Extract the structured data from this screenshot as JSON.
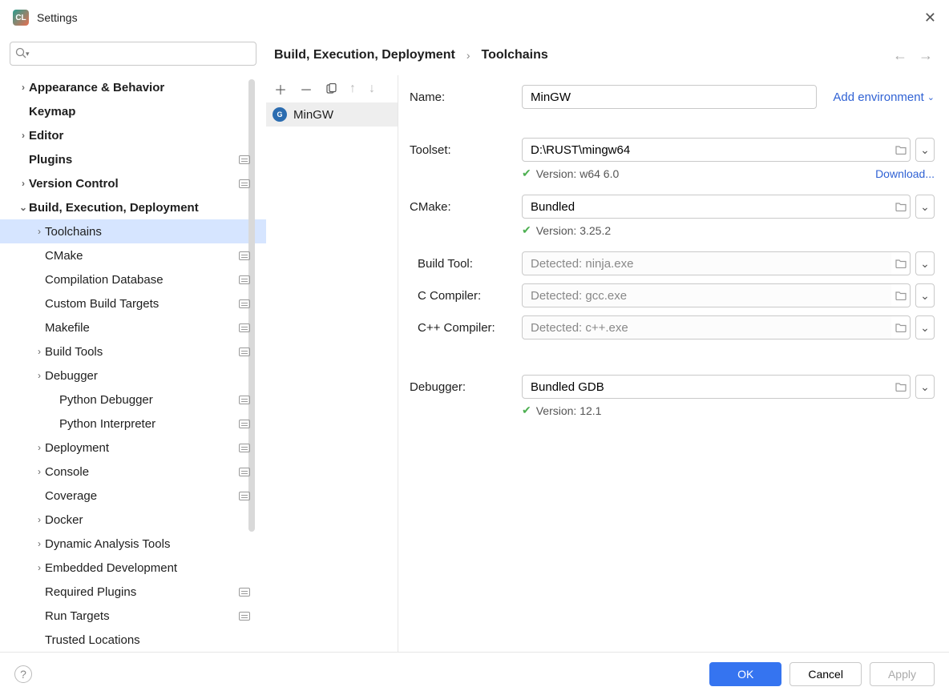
{
  "window": {
    "title": "Settings"
  },
  "breadcrumb": {
    "a": "Build, Execution, Deployment",
    "b": "Toolchains"
  },
  "tree": [
    {
      "lvl": 0,
      "chev": "r",
      "bold": true,
      "label": "Appearance & Behavior"
    },
    {
      "lvl": 0,
      "chev": "",
      "bold": true,
      "label": "Keymap"
    },
    {
      "lvl": 0,
      "chev": "r",
      "bold": true,
      "label": "Editor"
    },
    {
      "lvl": 0,
      "chev": "",
      "bold": true,
      "label": "Plugins",
      "cfg": true
    },
    {
      "lvl": 0,
      "chev": "r",
      "bold": true,
      "label": "Version Control",
      "cfg": true
    },
    {
      "lvl": 0,
      "chev": "d",
      "bold": true,
      "label": "Build, Execution, Deployment"
    },
    {
      "lvl": 1,
      "chev": "r",
      "bold": false,
      "label": "Toolchains",
      "selected": true
    },
    {
      "lvl": 1,
      "chev": "",
      "bold": false,
      "label": "CMake",
      "cfg": true
    },
    {
      "lvl": 1,
      "chev": "",
      "bold": false,
      "label": "Compilation Database",
      "cfg": true
    },
    {
      "lvl": 1,
      "chev": "",
      "bold": false,
      "label": "Custom Build Targets",
      "cfg": true
    },
    {
      "lvl": 1,
      "chev": "",
      "bold": false,
      "label": "Makefile",
      "cfg": true
    },
    {
      "lvl": 1,
      "chev": "r",
      "bold": false,
      "label": "Build Tools",
      "cfg": true
    },
    {
      "lvl": 1,
      "chev": "r",
      "bold": false,
      "label": "Debugger"
    },
    {
      "lvl": 2,
      "chev": "",
      "bold": false,
      "label": "Python Debugger",
      "cfg": true
    },
    {
      "lvl": 2,
      "chev": "",
      "bold": false,
      "label": "Python Interpreter",
      "cfg": true
    },
    {
      "lvl": 1,
      "chev": "r",
      "bold": false,
      "label": "Deployment",
      "cfg": true
    },
    {
      "lvl": 1,
      "chev": "r",
      "bold": false,
      "label": "Console",
      "cfg": true
    },
    {
      "lvl": 1,
      "chev": "",
      "bold": false,
      "label": "Coverage",
      "cfg": true
    },
    {
      "lvl": 1,
      "chev": "r",
      "bold": false,
      "label": "Docker"
    },
    {
      "lvl": 1,
      "chev": "r",
      "bold": false,
      "label": "Dynamic Analysis Tools"
    },
    {
      "lvl": 1,
      "chev": "r",
      "bold": false,
      "label": "Embedded Development"
    },
    {
      "lvl": 1,
      "chev": "",
      "bold": false,
      "label": "Required Plugins",
      "cfg": true
    },
    {
      "lvl": 1,
      "chev": "",
      "bold": false,
      "label": "Run Targets",
      "cfg": true
    },
    {
      "lvl": 1,
      "chev": "",
      "bold": false,
      "label": "Trusted Locations"
    }
  ],
  "toolchains": {
    "selected": "MinGW"
  },
  "form": {
    "name_label": "Name:",
    "name_value": "MinGW",
    "add_env": "Add environment",
    "toolset_label": "Toolset:",
    "toolset_value": "D:\\RUST\\mingw64",
    "toolset_ver": "Version: w64 6.0",
    "download": "Download...",
    "cmake_label": "CMake:",
    "cmake_value": "Bundled",
    "cmake_ver": "Version: 3.25.2",
    "build_label": "Build Tool:",
    "build_ph": "Detected: ninja.exe",
    "cc_label": "C Compiler:",
    "cc_ph": "Detected: gcc.exe",
    "cxx_label": "C++ Compiler:",
    "cxx_ph": "Detected: c++.exe",
    "dbg_label": "Debugger:",
    "dbg_value": "Bundled GDB",
    "dbg_ver": "Version: 12.1"
  },
  "footer": {
    "ok": "OK",
    "cancel": "Cancel",
    "apply": "Apply"
  }
}
